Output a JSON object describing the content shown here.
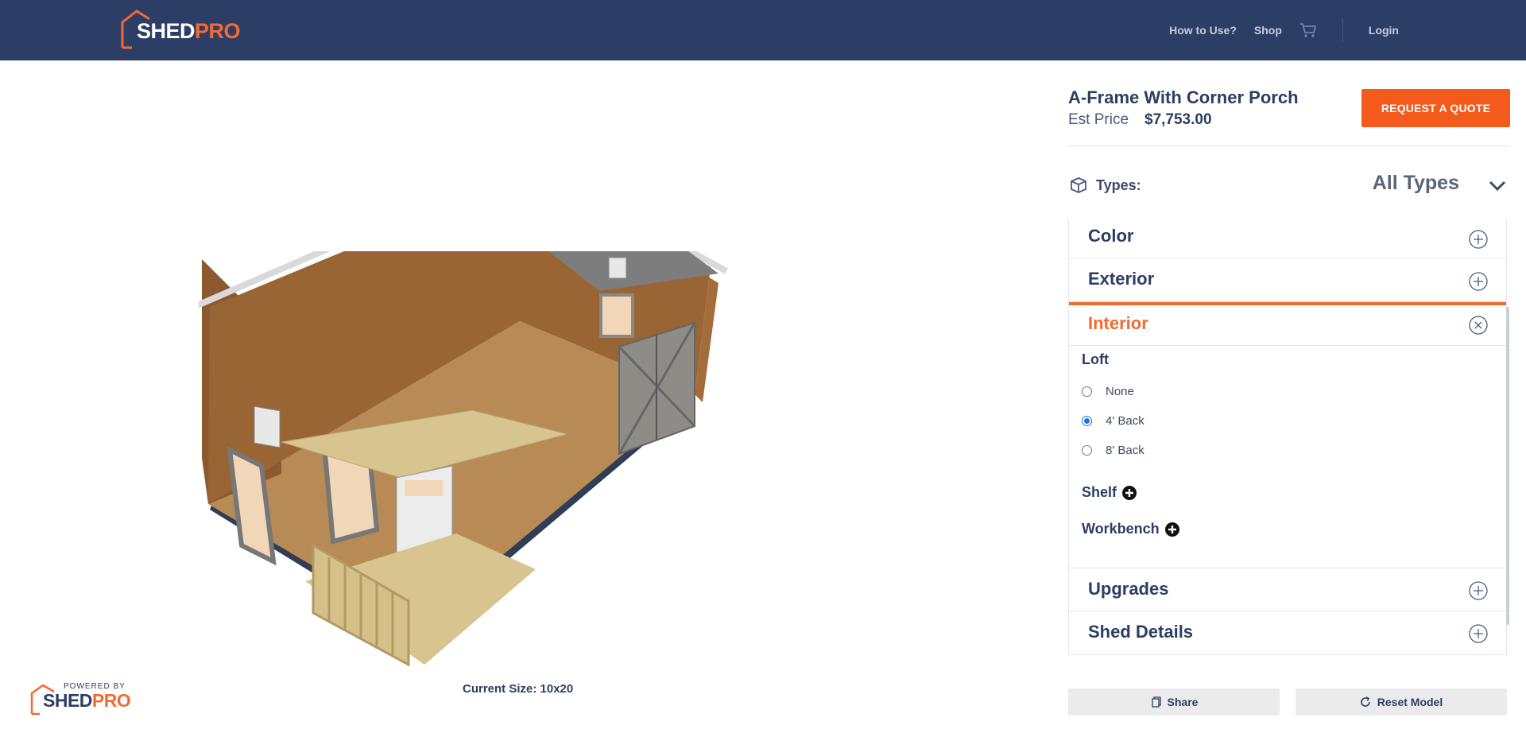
{
  "header": {
    "logo_word": "SHED",
    "logo_accent": "PRO",
    "nav": {
      "how_to_use": "How to Use?",
      "shop": "Shop",
      "login": "Login"
    },
    "cart_icon": "cart-icon"
  },
  "viewer": {
    "current_size": "Current Size: 10x20",
    "powered_by": "POWERED BY",
    "powered_word": "SHED",
    "powered_accent": "PRO"
  },
  "product": {
    "name": "A-Frame With Corner Porch",
    "est_label": "Est Price",
    "est_price": "$7,753.00",
    "quote_button": "REQUEST A QUOTE"
  },
  "types": {
    "label": "Types:",
    "value": "All Types"
  },
  "accordion": {
    "color": "Color",
    "exterior": "Exterior",
    "interior": "Interior",
    "upgrades": "Upgrades",
    "shed_details": "Shed Details"
  },
  "interior": {
    "loft_label": "Loft",
    "loft_options": [
      "None",
      "4' Back",
      "8' Back"
    ],
    "loft_selected": "4' Back",
    "shelf": "Shelf",
    "workbench": "Workbench"
  },
  "actions": {
    "share": "Share",
    "reset": "Reset Model"
  },
  "colors": {
    "header_bg": "#2d3e66",
    "accent": "#f26a32",
    "quote_bg": "#f45a1c",
    "text_dark": "#2c3e63"
  }
}
